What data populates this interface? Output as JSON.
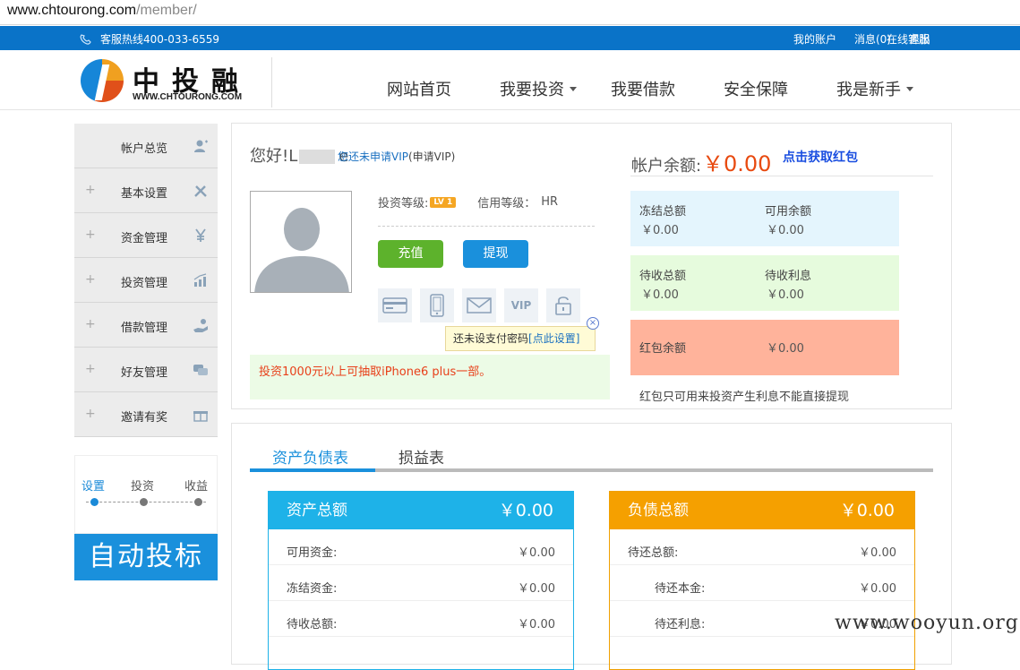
{
  "browser": {
    "url_host": "www.chtourong.com",
    "url_path": "/member/"
  },
  "topbar": {
    "hotline": "客服热线400-033-6559",
    "links": [
      "我的账户",
      "消息(0)",
      "退出"
    ],
    "service": "在线客服"
  },
  "header": {
    "logo_cn": "中投融",
    "logo_en": "WWW.CHTOURONG.COM",
    "nav": [
      {
        "label": "网站首页",
        "dropdown": false
      },
      {
        "label": "我要投资",
        "dropdown": true
      },
      {
        "label": "我要借款",
        "dropdown": false
      },
      {
        "label": "安全保障",
        "dropdown": false
      },
      {
        "label": "我是新手",
        "dropdown": true
      }
    ]
  },
  "sidebar": {
    "items": [
      {
        "label": "帐户总览",
        "icon": "user-icon",
        "expandable": false
      },
      {
        "label": "基本设置",
        "icon": "tools-icon",
        "expandable": true
      },
      {
        "label": "资金管理",
        "icon": "yen-icon",
        "expandable": true
      },
      {
        "label": "投资管理",
        "icon": "chart-icon",
        "expandable": true
      },
      {
        "label": "借款管理",
        "icon": "hand-icon",
        "expandable": true
      },
      {
        "label": "好友管理",
        "icon": "chat-icon",
        "expandable": true
      },
      {
        "label": "邀请有奖",
        "icon": "gift-icon",
        "expandable": true
      }
    ],
    "plus": "+",
    "steps": [
      "设置",
      "投资",
      "收益"
    ],
    "autobid": "自动投标"
  },
  "account": {
    "greeting": "您好!L",
    "greeting_tail": "e",
    "vip_status": "您还未申请VIP",
    "vip_apply": "(申请VIP)",
    "balance_label": "帐户余额:",
    "balance_value": "￥0.00",
    "redpack_link": "点击获取红包",
    "level_label": "投资等级:",
    "level_badge": "LV 1",
    "credit_label": "信用等级：",
    "credit_value": "HR",
    "recharge": "充值",
    "withdraw": "提现",
    "security_icons": [
      "bankcard-icon",
      "mobile-icon",
      "email-icon",
      "vip-icon",
      "lock-icon"
    ],
    "vip_icon_text": "VIP",
    "tip_text": "还未设支付密码",
    "tip_link": "[点此设置]",
    "promo": "投资1000元以上可抽取iPhone6 plus一部。",
    "funds": {
      "frozen_label": "冻结总额",
      "frozen_value": "￥0.00",
      "available_label": "可用余额",
      "available_value": "￥0.00",
      "pending_label": "待收总额",
      "pending_value": "￥0.00",
      "interest_label": "待收利息",
      "interest_value": "￥0.00",
      "redpack_label": "红包余额",
      "redpack_value": "￥0.00"
    },
    "note": "红包只可用来投资产生利息不能直接提现"
  },
  "statements": {
    "tabs": [
      "资产负债表",
      "损益表"
    ],
    "assets": {
      "title": "资产总额",
      "total": "￥0.00",
      "rows": [
        {
          "label": "可用资金:",
          "value": "￥0.00"
        },
        {
          "label": "冻结资金:",
          "value": "￥0.00"
        },
        {
          "label": "待收总额:",
          "value": "￥0.00"
        }
      ]
    },
    "debts": {
      "title": "负债总额",
      "total": "￥0.00",
      "rows": [
        {
          "label": "待还总额:",
          "value": "￥0.00"
        },
        {
          "label": "待还本金:",
          "value": "￥0.00"
        },
        {
          "label": "待还利息:",
          "value": "￥0.00"
        }
      ]
    }
  },
  "watermark": "www.wooyun.org"
}
